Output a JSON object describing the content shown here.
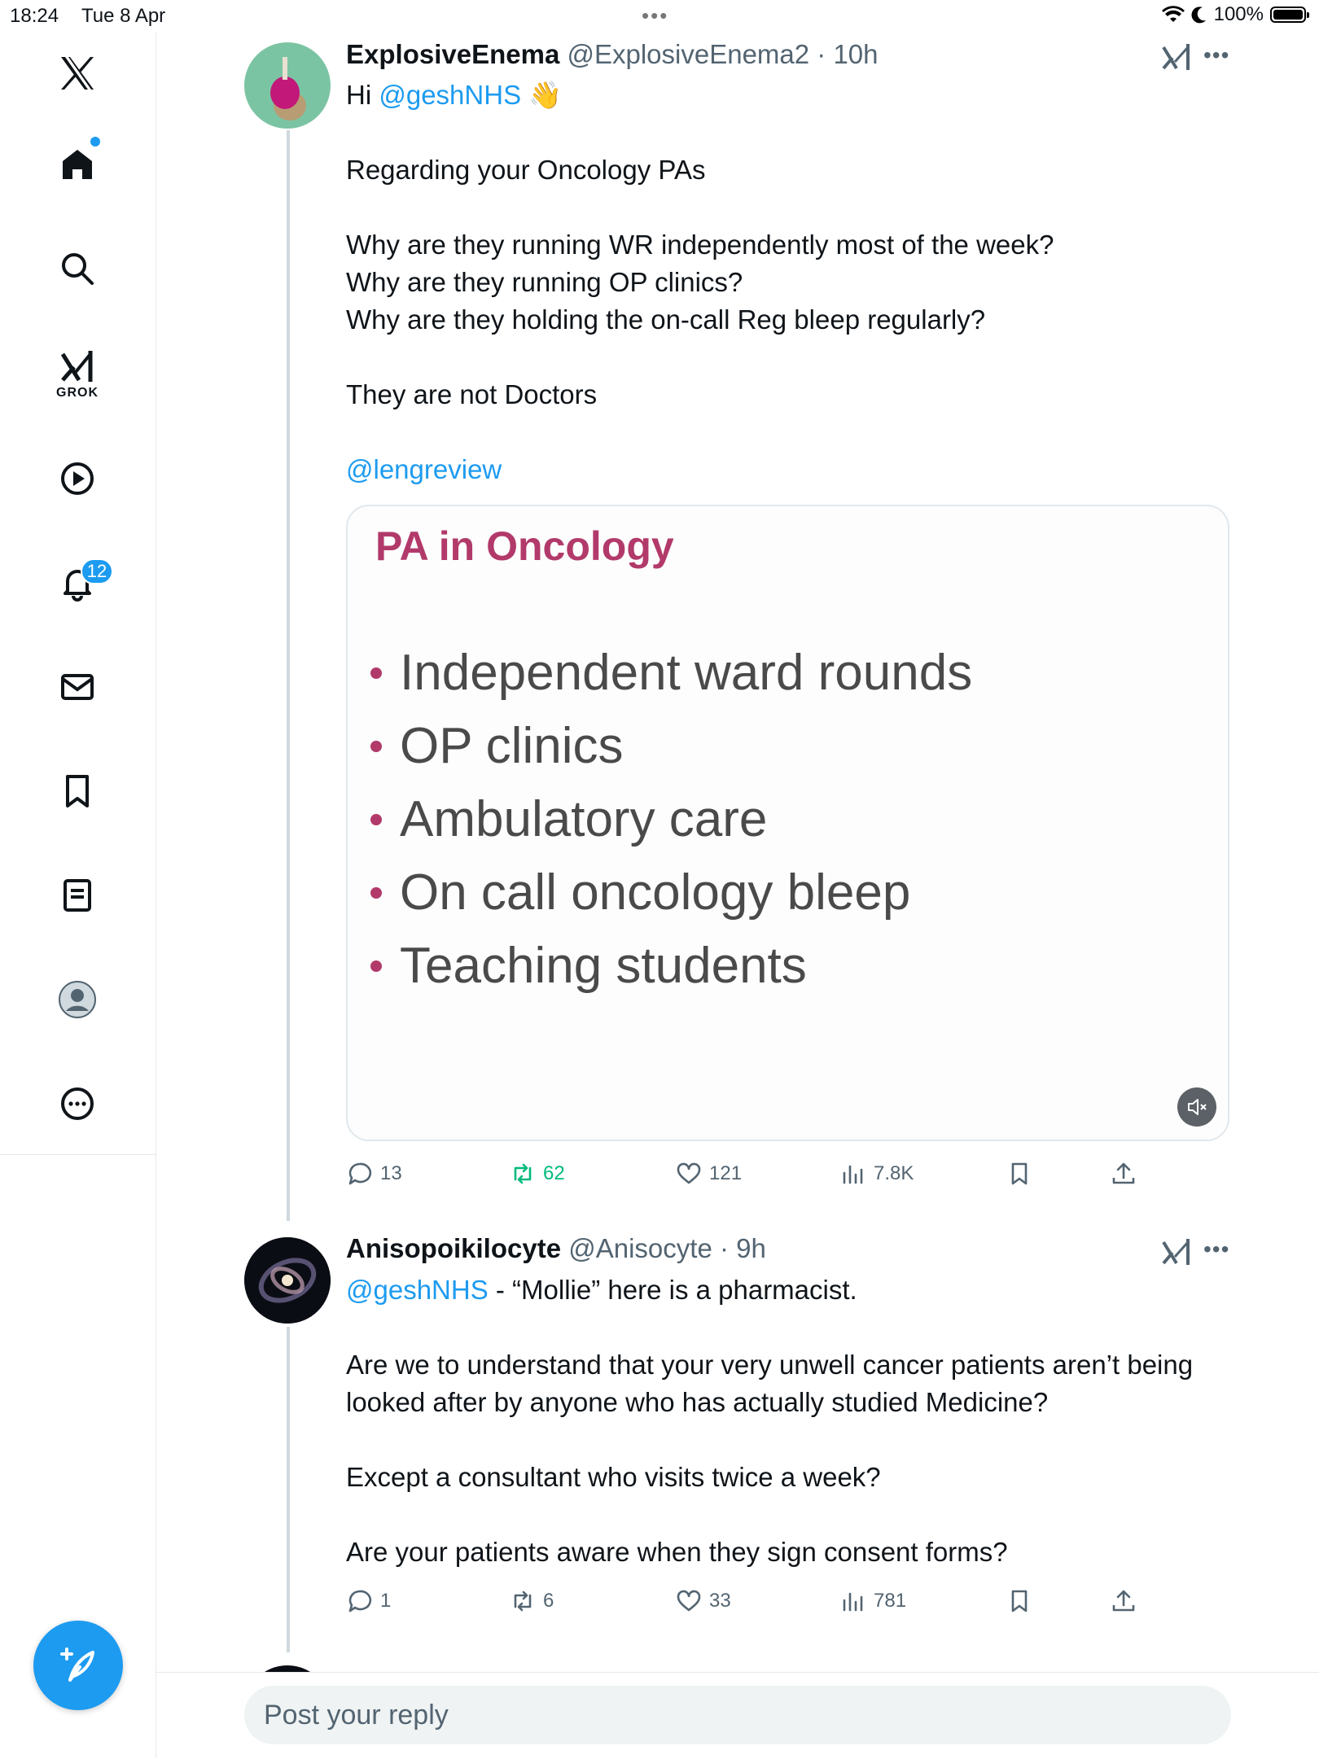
{
  "status_bar": {
    "time": "18:24",
    "date": "Tue 8 Apr",
    "battery": "100%"
  },
  "sidebar": {
    "grok_label": "GROK",
    "notification_count": "12"
  },
  "tweets": [
    {
      "display_name": "ExplosiveEnema",
      "handle": "@ExplosiveEnema2",
      "time": "10h",
      "greeting_prefix": "Hi ",
      "greeting_mention": "@geshNHS",
      "greeting_emoji": "👋",
      "lines": [
        "Regarding your Oncology PAs",
        "Why are they running WR independently most of the week?",
        "Why are they running OP clinics?",
        "Why are they holding the on-call Reg bleep regularly?",
        "They are not Doctors"
      ],
      "mention_line": "@lengreview",
      "media": {
        "slide_title": "PA in Oncology",
        "bullets": [
          "Independent ward rounds",
          "OP clinics",
          "Ambulatory care",
          "On call oncology bleep",
          "Teaching students"
        ]
      },
      "stats": {
        "replies": "13",
        "reposts": "62",
        "likes": "121",
        "views": "7.8K"
      }
    },
    {
      "display_name": "Anisopoikilocyte",
      "handle": "@Anisocyte",
      "time": "9h",
      "first_mention": "@geshNHS",
      "first_line_rest": " - “Mollie” here is a pharmacist.",
      "lines": [
        "Are we to understand that your very unwell cancer patients aren’t being looked after by anyone who has actually studied Medicine?",
        "Except a consultant who visits twice a week?",
        "Are your patients aware when they sign consent forms?"
      ],
      "stats": {
        "replies": "1",
        "reposts": "6",
        "likes": "33",
        "views": "781"
      }
    }
  ],
  "reply_bar": {
    "placeholder": "Post your reply"
  },
  "colors": {
    "accent": "#1d9bf0",
    "repost_green": "#00ba7c",
    "slide_accent": "#b23a6a"
  },
  "icons": [
    "x-logo-icon",
    "home-icon",
    "search-icon",
    "grok-icon",
    "video-icon",
    "bell-icon",
    "mail-icon",
    "bookmark-icon",
    "lists-icon",
    "profile-icon",
    "more-icon",
    "compose-icon",
    "reply-icon",
    "repost-icon",
    "like-icon",
    "views-icon",
    "share-icon",
    "mute-icon"
  ]
}
